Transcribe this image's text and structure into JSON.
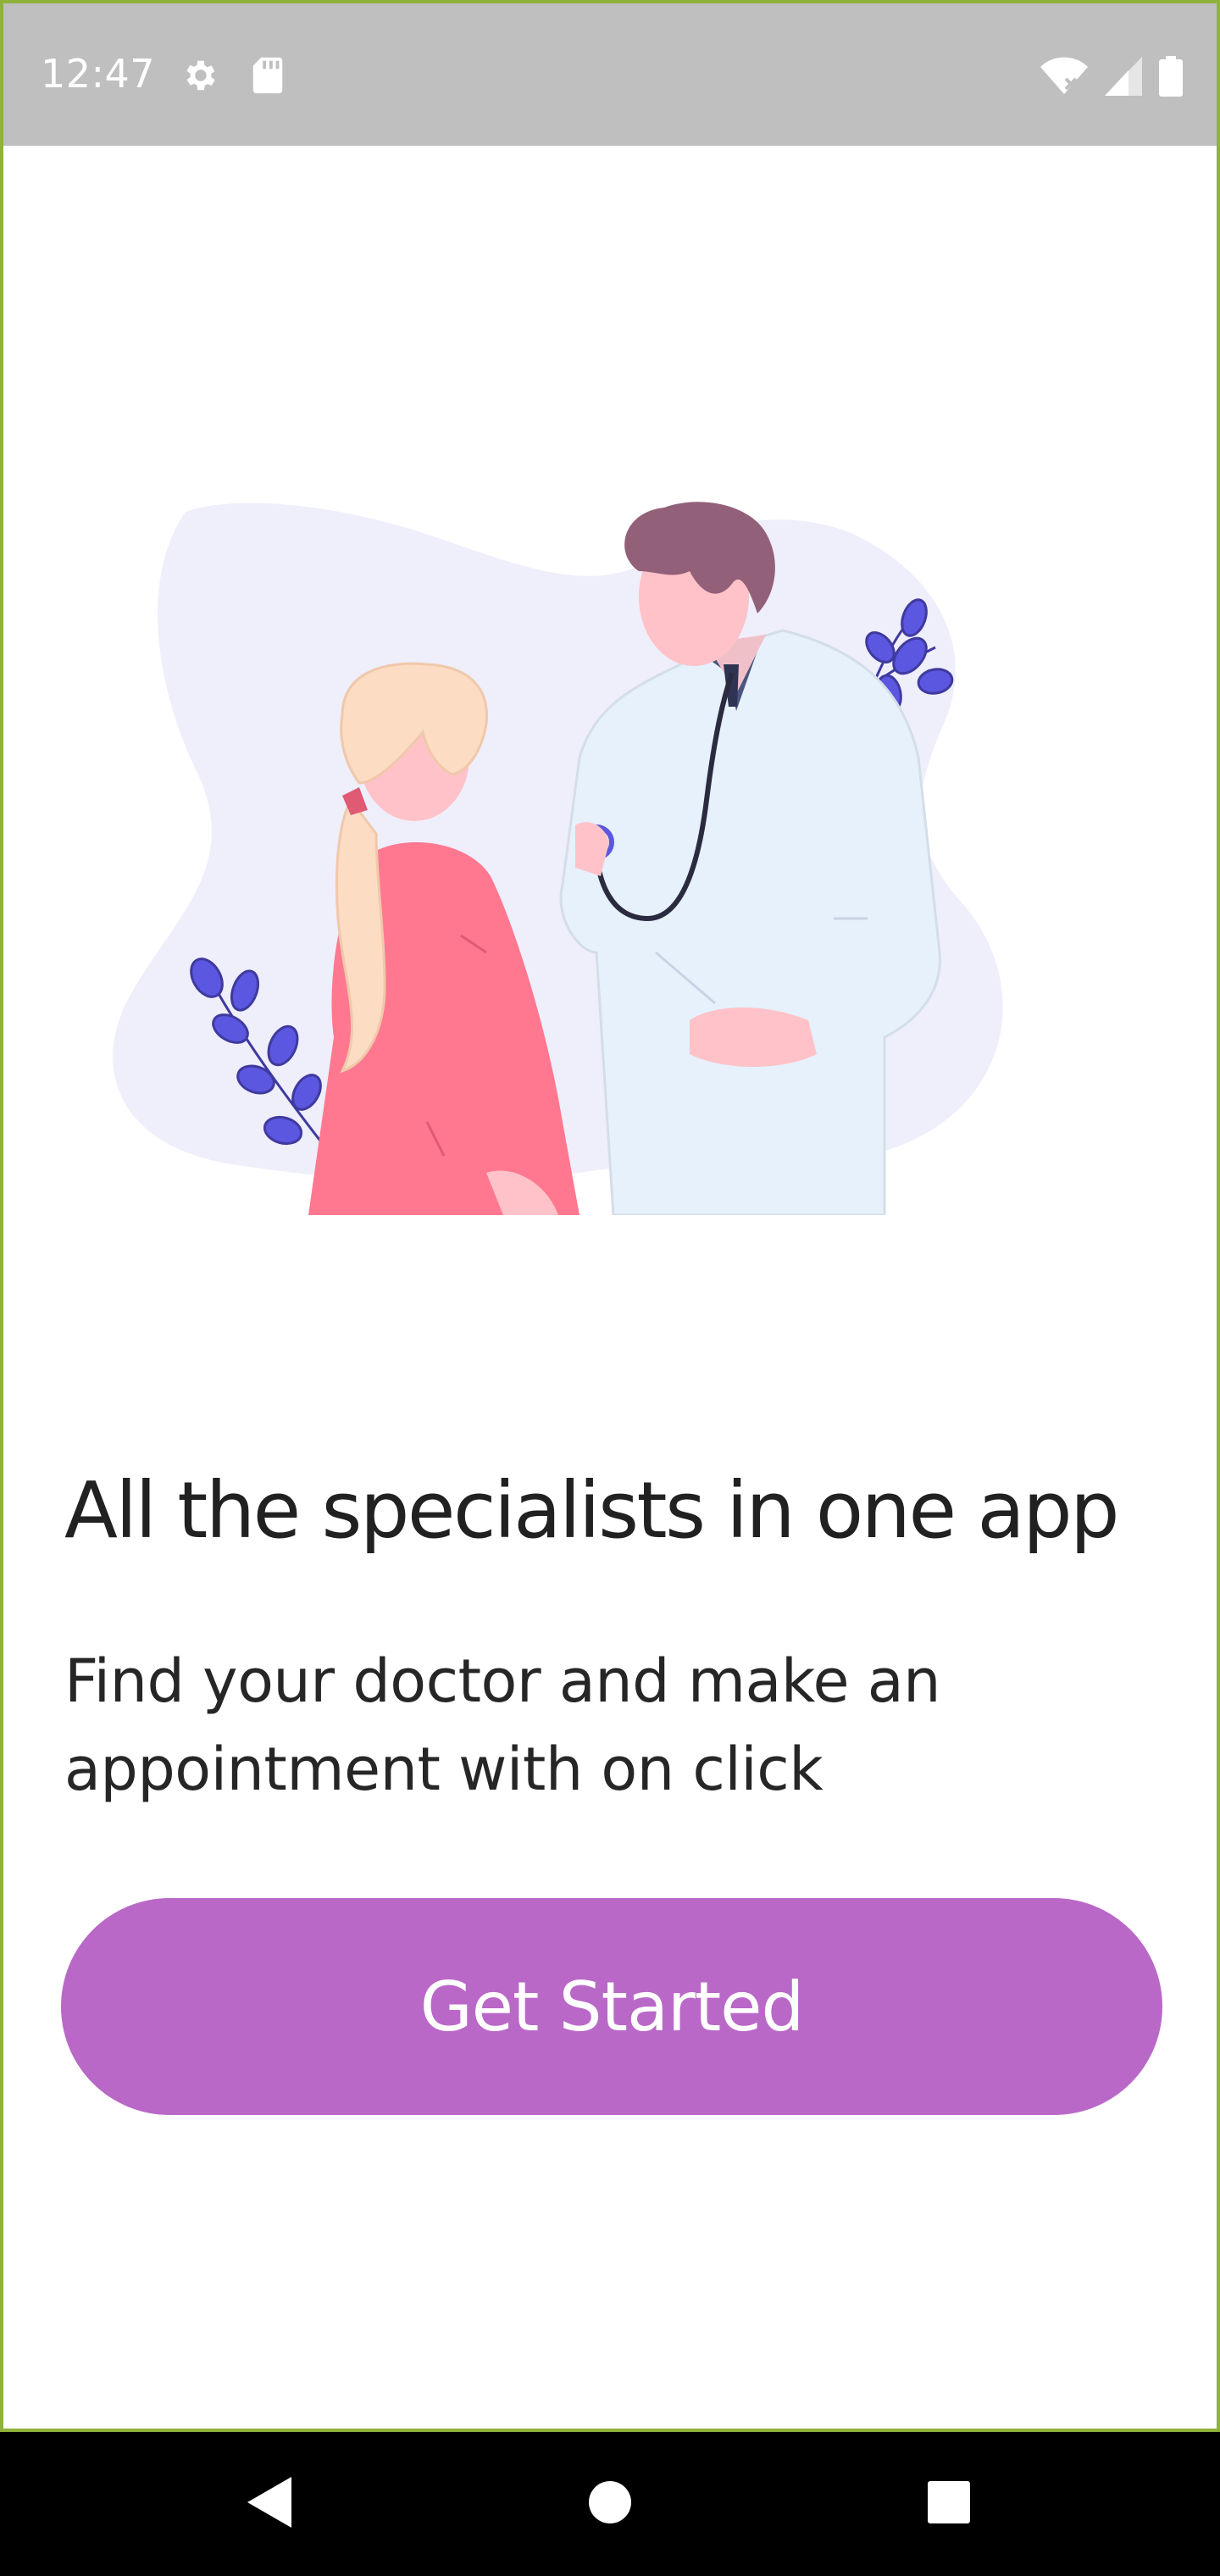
{
  "status_bar": {
    "time": "12:47",
    "left_icons": [
      "gear-icon",
      "sd-card-icon"
    ],
    "right_icons": [
      "wifi-off-icon",
      "cell-signal-icon",
      "battery-icon"
    ]
  },
  "onboarding": {
    "headline": "All the specialists in one app",
    "subtitle": "Find your doctor and make an appointment with on click",
    "cta_label": "Get Started"
  },
  "nav_bar": {
    "icons": [
      "back-icon",
      "home-icon",
      "recents-icon"
    ]
  },
  "colors": {
    "status_bar_bg": "#bfbfbf",
    "accent": "#b968c8",
    "frame_border": "#8fb339",
    "illustration_blob": "#efeefb",
    "leaf": "#5b57e0",
    "dress": "#ff7890",
    "coat": "#e6f1fc",
    "hair_doctor": "#93607a"
  }
}
